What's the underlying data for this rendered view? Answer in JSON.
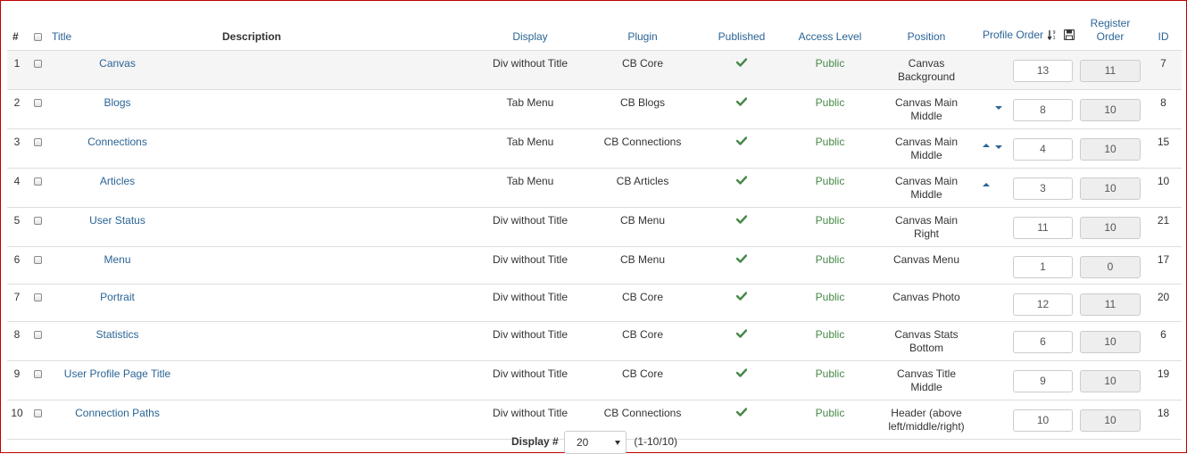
{
  "headers": {
    "num": "#",
    "title": "Title",
    "description": "Description",
    "display": "Display",
    "plugin": "Plugin",
    "published": "Published",
    "access": "Access Level",
    "position": "Position",
    "profile_order": "Profile Order",
    "register_order_line1": "Register",
    "register_order_line2": "Order",
    "id": "ID"
  },
  "rows": [
    {
      "num": "1",
      "title": "Canvas",
      "description": "",
      "display": "Div without Title",
      "plugin": "CB Core",
      "published": true,
      "access": "Public",
      "position_line1": "Canvas",
      "position_line2": "Background",
      "up": false,
      "down": false,
      "profile_order": "13",
      "register_order": "11",
      "id": "7"
    },
    {
      "num": "2",
      "title": "Blogs",
      "description": "",
      "display": "Tab Menu",
      "plugin": "CB Blogs",
      "published": true,
      "access": "Public",
      "position_line1": "Canvas Main",
      "position_line2": "Middle",
      "up": false,
      "down": true,
      "profile_order": "8",
      "register_order": "10",
      "id": "8"
    },
    {
      "num": "3",
      "title": "Connections",
      "description": "",
      "display": "Tab Menu",
      "plugin": "CB Connections",
      "published": true,
      "access": "Public",
      "position_line1": "Canvas Main",
      "position_line2": "Middle",
      "up": true,
      "down": true,
      "profile_order": "4",
      "register_order": "10",
      "id": "15"
    },
    {
      "num": "4",
      "title": "Articles",
      "description": "",
      "display": "Tab Menu",
      "plugin": "CB Articles",
      "published": true,
      "access": "Public",
      "position_line1": "Canvas Main",
      "position_line2": "Middle",
      "up": true,
      "down": false,
      "profile_order": "3",
      "register_order": "10",
      "id": "10"
    },
    {
      "num": "5",
      "title": "User Status",
      "description": "",
      "display": "Div without Title",
      "plugin": "CB Menu",
      "published": true,
      "access": "Public",
      "position_line1": "Canvas Main",
      "position_line2": "Right",
      "up": false,
      "down": false,
      "profile_order": "11",
      "register_order": "10",
      "id": "21"
    },
    {
      "num": "6",
      "title": "Menu",
      "description": "",
      "display": "Div without Title",
      "plugin": "CB Menu",
      "published": true,
      "access": "Public",
      "position_line1": "Canvas Menu",
      "position_line2": "",
      "up": false,
      "down": false,
      "profile_order": "1",
      "register_order": "0",
      "id": "17"
    },
    {
      "num": "7",
      "title": "Portrait",
      "description": "",
      "display": "Div without Title",
      "plugin": "CB Core",
      "published": true,
      "access": "Public",
      "position_line1": "Canvas Photo",
      "position_line2": "",
      "up": false,
      "down": false,
      "profile_order": "12",
      "register_order": "11",
      "id": "20"
    },
    {
      "num": "8",
      "title": "Statistics",
      "description": "",
      "display": "Div without Title",
      "plugin": "CB Core",
      "published": true,
      "access": "Public",
      "position_line1": "Canvas Stats",
      "position_line2": "Bottom",
      "up": false,
      "down": false,
      "profile_order": "6",
      "register_order": "10",
      "id": "6"
    },
    {
      "num": "9",
      "title": "User Profile Page Title",
      "description": "",
      "display": "Div without Title",
      "plugin": "CB Core",
      "published": true,
      "access": "Public",
      "position_line1": "Canvas Title",
      "position_line2": "Middle",
      "up": false,
      "down": false,
      "profile_order": "9",
      "register_order": "10",
      "id": "19"
    },
    {
      "num": "10",
      "title": "Connection Paths",
      "description": "",
      "display": "Div without Title",
      "plugin": "CB Connections",
      "published": true,
      "access": "Public",
      "position_line1": "Header (above",
      "position_line2": "left/middle/right)",
      "up": false,
      "down": false,
      "profile_order": "10",
      "register_order": "10",
      "id": "18"
    }
  ],
  "footer": {
    "display_label": "Display #",
    "display_value": "20",
    "range": "(1-10/10)"
  },
  "colors": {
    "link": "#2a6496",
    "published_check": "#468847",
    "frame_border": "#c00000"
  },
  "icons": {
    "published": "check-icon",
    "sort": "sort-numeric-icon",
    "save_order": "save-disk-icon",
    "move_up": "arrow-up-icon",
    "move_down": "arrow-down-icon"
  }
}
